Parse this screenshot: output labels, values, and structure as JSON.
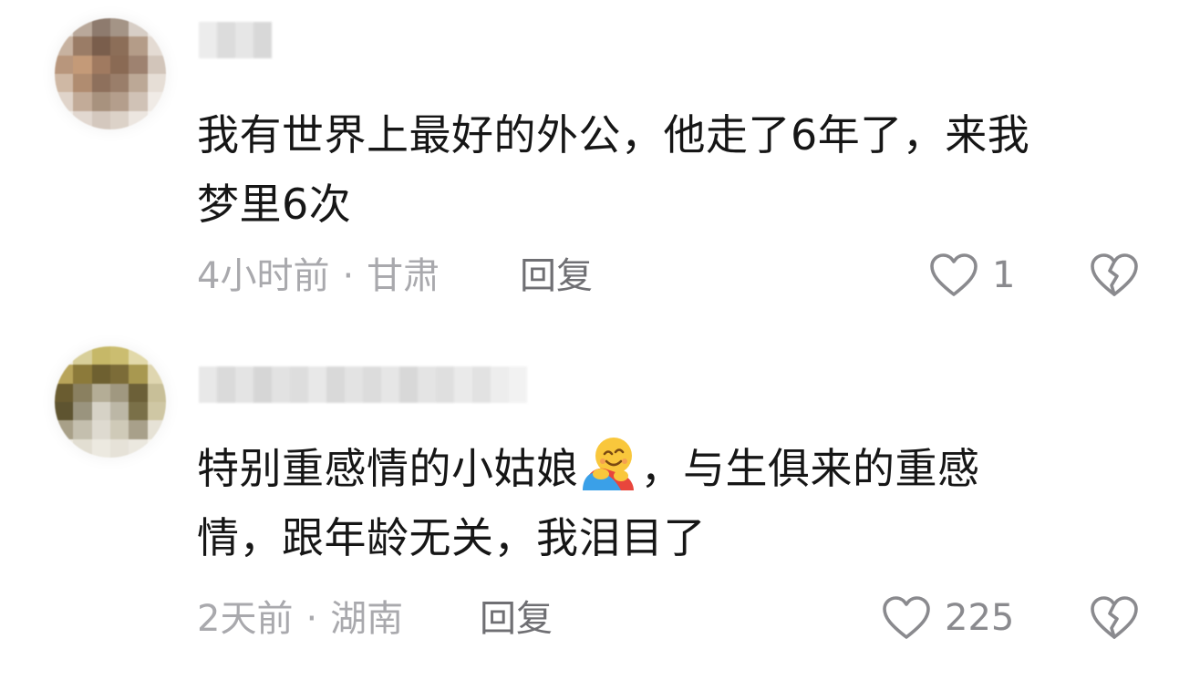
{
  "comments": [
    {
      "text_line1": "我有世界上最好的外公，他走了6年了，来我",
      "text_line2": "梦里6次",
      "time": "4小时前",
      "separator": "·",
      "location": "甘肃",
      "reply_label": "回复",
      "like_count": "1",
      "like_icon": "heart-outline-icon",
      "dislike_icon": "broken-heart-icon"
    },
    {
      "text_line1_before_emoji": "特别重感情的小姑娘",
      "emoji": "hugging-face-emoji",
      "text_line1_after_emoji": "，与生俱来的重感",
      "text_line2": "情，跟年龄无关，我泪目了",
      "time": "2天前",
      "separator": "·",
      "location": "湖南",
      "reply_label": "回复",
      "like_count": "225",
      "like_icon": "heart-outline-icon",
      "dislike_icon": "broken-heart-icon"
    }
  ],
  "colors": {
    "text": "#161616",
    "meta": "#a9a9ad",
    "reply": "#6f6f73",
    "icon": "#8a8a8e"
  }
}
